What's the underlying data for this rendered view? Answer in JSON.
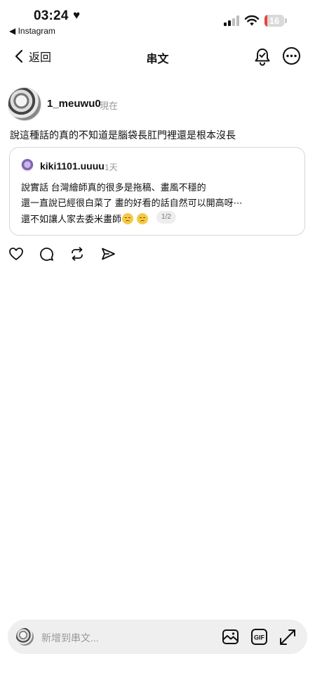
{
  "status_bar": {
    "time": "03:24",
    "back_app": "◀ Instagram",
    "battery_level": "16",
    "battery_fraction": 0.16
  },
  "nav": {
    "back_label": "返回",
    "title": "串文"
  },
  "post": {
    "username": "1_meuwu0",
    "time": "現在",
    "text": "說這種話的真的不知道是腦袋長肛門裡還是根本沒長",
    "quoted": {
      "username": "kiki1101.uuuu",
      "time": "1天",
      "line1": "說實話 台灣繪師真的很多是拖稿、畫風不穩的",
      "line2": "還一直說已經很白菜了 畫的好看的話自然可以開高呀⋯",
      "line3": "還不如讓人家去委米畫師",
      "emojis": [
        "disappointed-face",
        "disappointed-face"
      ],
      "page_indicator": "1/2"
    }
  },
  "composer": {
    "placeholder": "新增到串文..."
  },
  "colors": {
    "background": "#ffffff",
    "text": "#111111",
    "muted": "#999999",
    "battery_low": "#e8413b",
    "composer_bg": "#efefef"
  }
}
